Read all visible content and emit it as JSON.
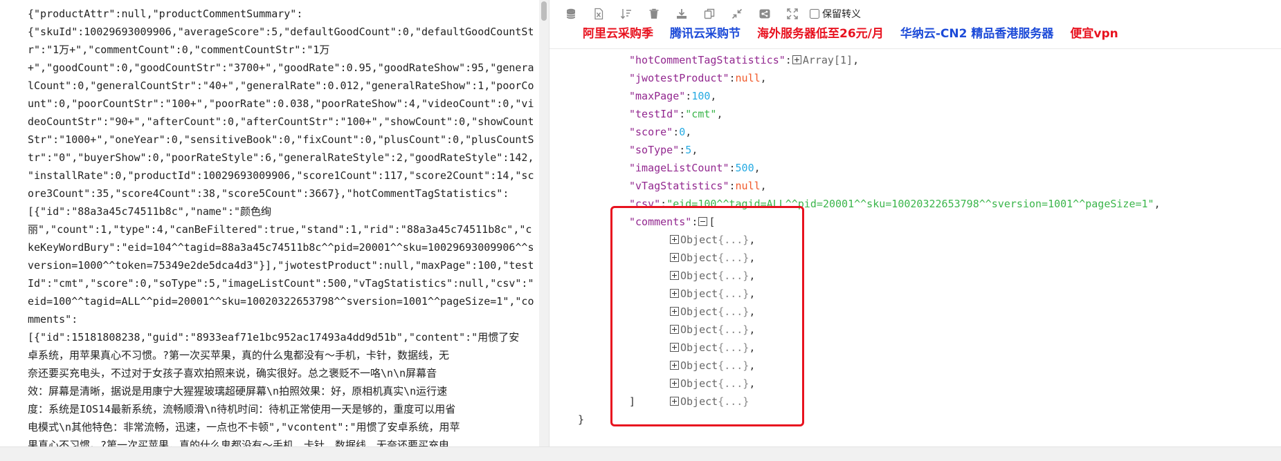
{
  "raw_text_lines": [
    "{\"productAttr\":null,\"productCommentSummary\":",
    "{\"skuId\":10029693009906,\"averageScore\":5,\"defaultGoodCount\":0,\"defaultGoodCountSt",
    "r\":\"1万+\",\"commentCount\":0,\"commentCountStr\":\"1万",
    "+\",\"goodCount\":0,\"goodCountStr\":\"3700+\",\"goodRate\":0.95,\"goodRateShow\":95,\"genera",
    "lCount\":0,\"generalCountStr\":\"40+\",\"generalRate\":0.012,\"generalRateShow\":1,\"poorCo",
    "unt\":0,\"poorCountStr\":\"100+\",\"poorRate\":0.038,\"poorRateShow\":4,\"videoCount\":0,\"vi",
    "deoCountStr\":\"90+\",\"afterCount\":0,\"afterCountStr\":\"100+\",\"showCount\":0,\"showCount",
    "Str\":\"1000+\",\"oneYear\":0,\"sensitiveBook\":0,\"fixCount\":0,\"plusCount\":0,\"plusCountS",
    "tr\":\"0\",\"buyerShow\":0,\"poorRateStyle\":6,\"generalRateStyle\":2,\"goodRateStyle\":142,",
    "\"installRate\":0,\"productId\":10029693009906,\"score1Count\":117,\"score2Count\":14,\"sc",
    "ore3Count\":35,\"score4Count\":38,\"score5Count\":3667},\"hotCommentTagStatistics\":",
    "[{\"id\":\"88a3a45c74511b8c\",\"name\":\"颜色绚",
    "丽\",\"count\":1,\"type\":4,\"canBeFiltered\":true,\"stand\":1,\"rid\":\"88a3a45c74511b8c\",\"c",
    "keKeyWordBury\":\"eid=104^^tagid=88a3a45c74511b8c^^pid=20001^^sku=10029693009906^^s",
    "version=1000^^token=75349e2de5dca4d3\"}],\"jwotestProduct\":null,\"maxPage\":100,\"test",
    "Id\":\"cmt\",\"score\":0,\"soType\":5,\"imageListCount\":500,\"vTagStatistics\":null,\"csv\":\"",
    "eid=100^^tagid=ALL^^pid=20001^^sku=10020322653798^^sversion=1001^^pageSize=1\",\"co",
    "mments\":",
    "[{\"id\":15181808238,\"guid\":\"8933eaf71e1bc952ac17493a4dd9d51b\",\"content\":\"用惯了安",
    "卓系统，用苹果真心不习惯。?第一次买苹果，真的什么鬼都没有～手机，卡针，数据线，无",
    "奈还要买充电头，不过对于女孩子喜欢拍照来说，确实很好。总之褒贬不一咯\\n\\n屏幕音",
    "效：屏幕是清晰，据说是用康宁大猩猩玻璃超硬屏幕\\n拍照效果：好，原相机真实\\n运行速",
    "度：系统是IOS14最新系统，流畅顺滑\\n待机时间：待机正常使用一天是够的，重度可以用省",
    "电模式\\n其他特色：非常流畅，迅速，一点也不卡顿\",\"vcontent\":\"用惯了安卓系统，用苹",
    "果真心不习惯。?第一次买苹果，真的什么鬼都没有～手机，卡针，数据线，无奈还要买充电"
  ],
  "toolbar": {
    "icons": [
      "database-icon",
      "excel-export-icon",
      "sort-icon",
      "delete-icon",
      "download-icon",
      "copy-icon",
      "collapse-icon",
      "share-icon",
      "expand-icon"
    ],
    "keep_escape_label": "保留转义",
    "keep_escape_checked": false
  },
  "ads": [
    {
      "label": "阿里云采购季",
      "color": "#e8121f"
    },
    {
      "label": "腾讯云采购节",
      "color": "#1d4bd8"
    },
    {
      "label": "海外服务器低至26元/月",
      "color": "#e8121f"
    },
    {
      "label": "华纳云-CN2 精品香港服务器",
      "color": "#1d4bd8"
    },
    {
      "label": "便宜vpn",
      "color": "#e8121f"
    }
  ],
  "json_view": {
    "hotCommentTagStatistics": {
      "key": "\"hotCommentTagStatistics\"",
      "collapsed": "Array[1]"
    },
    "jwotestProduct": {
      "key": "\"jwotestProduct\"",
      "value": "null"
    },
    "maxPage": {
      "key": "\"maxPage\"",
      "value": "100"
    },
    "testId": {
      "key": "\"testId\"",
      "value": "\"cmt\""
    },
    "score": {
      "key": "\"score\"",
      "value": "0"
    },
    "soType": {
      "key": "\"soType\"",
      "value": "5"
    },
    "imageListCount": {
      "key": "\"imageListCount\"",
      "value": "500"
    },
    "vTagStatistics": {
      "key": "\"vTagStatistics\"",
      "value": "null"
    },
    "csv": {
      "key": "\"csv\"",
      "value": "\"eid=100^^tagid=ALL^^pid=20001^^sku=10020322653798^^sversion=1001^^pageSize=1\""
    },
    "comments": {
      "key": "\"comments\"",
      "open": "[",
      "close": "]"
    },
    "comment_items": [
      {
        "label": "Object",
        "dots": "{...}",
        "sep": ","
      },
      {
        "label": "Object",
        "dots": "{...}",
        "sep": ","
      },
      {
        "label": "Object",
        "dots": "{...}",
        "sep": ","
      },
      {
        "label": "Object",
        "dots": "{...}",
        "sep": ","
      },
      {
        "label": "Object",
        "dots": "{...}",
        "sep": ","
      },
      {
        "label": "Object",
        "dots": "{...}",
        "sep": ","
      },
      {
        "label": "Object",
        "dots": "{...}",
        "sep": ","
      },
      {
        "label": "Object",
        "dots": "{...}",
        "sep": ","
      },
      {
        "label": "Object",
        "dots": "{...}",
        "sep": ","
      },
      {
        "label": "Object",
        "dots": "{...}",
        "sep": ""
      }
    ],
    "root_close": "}",
    "highlight_color": "#e8121f"
  }
}
